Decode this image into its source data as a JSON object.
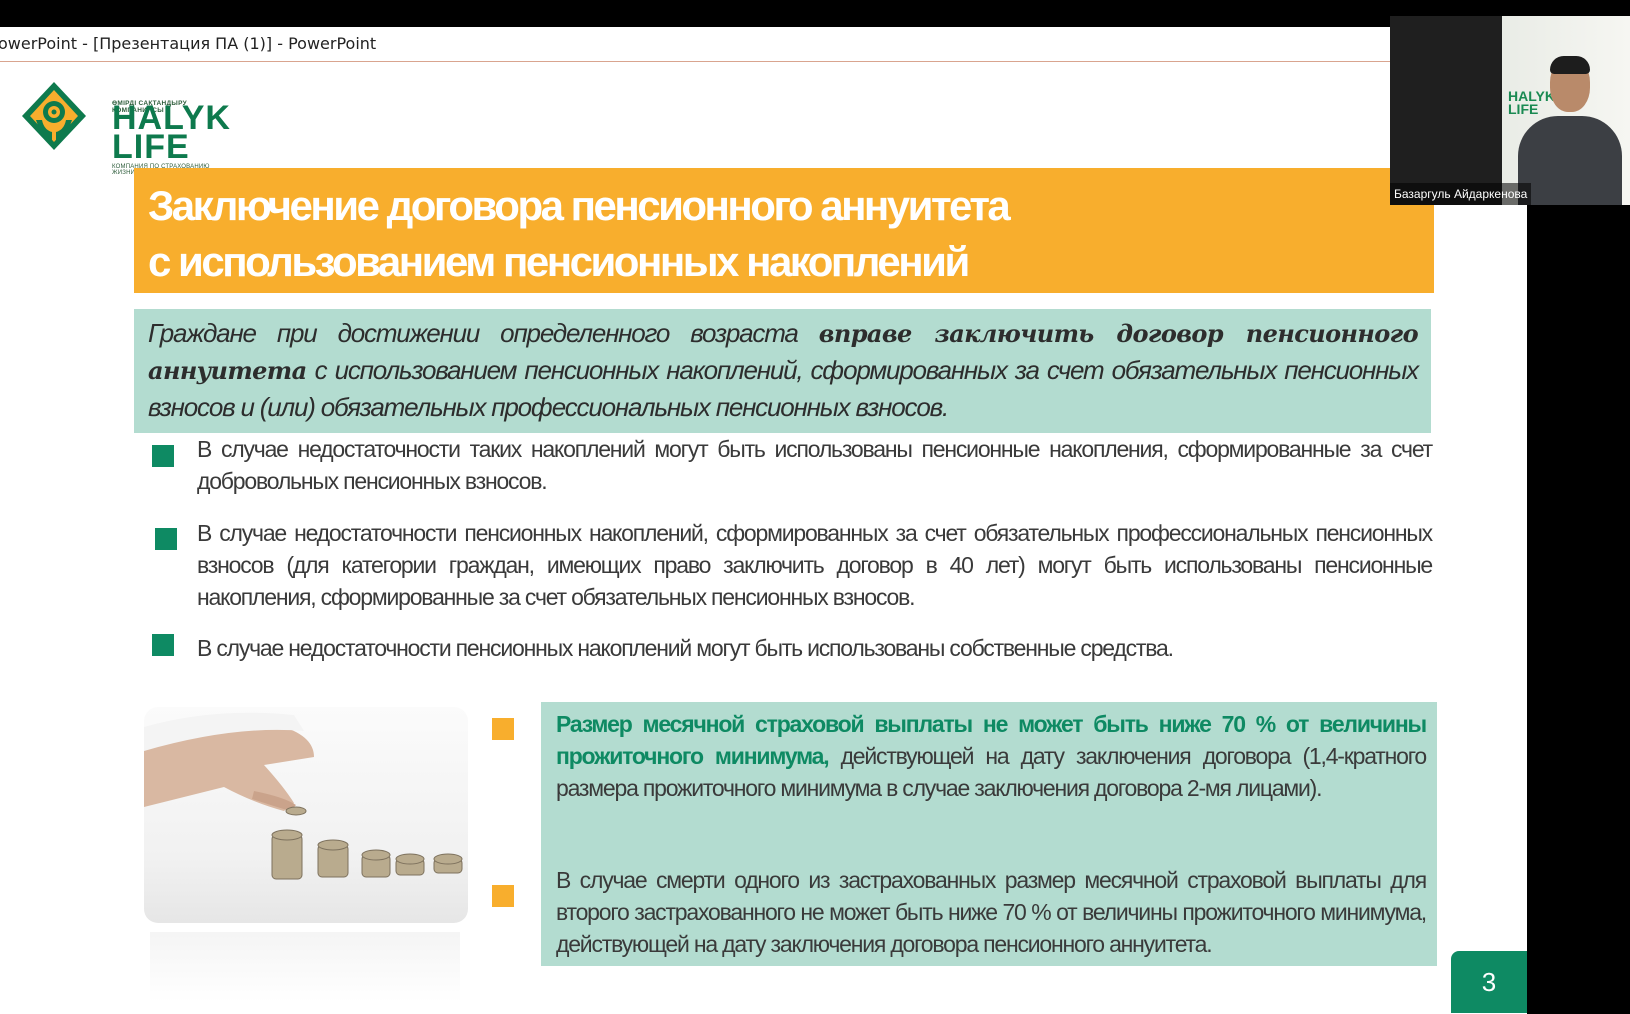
{
  "window": {
    "title": "owerPoint - [Презентация ПА (1)] - PowerPoint"
  },
  "logo": {
    "tagline": "ӨМІРДІ САҚТАНДЫРУ КОМПАНИЯСЫ",
    "word1": "HALYK",
    "word2": "LIFE",
    "subtitle": "КОМПАНИЯ ПО СТРАХОВАНИЮ ЖИЗНИ"
  },
  "slide": {
    "title_line1": "Заключение договора пенсионного аннуитета",
    "title_line2": "с использованием пенсионных накоплений",
    "intro_part1": "Граждане при достижении определенного возраста ",
    "intro_bold": "вправе заключить договор пенсионного аннуитета",
    "intro_part2": " с использованием пенсионных накоплений, сформированных за счет обязательных пенсионных взносов и (или) обязательных профессиональных пенсионных взносов.",
    "bullets": [
      "В случае недостаточности таких накоплений могут быть использованы пенсионные накопления, сформированные за счет добровольных пенсионных взносов.",
      "В случае недостаточности пенсионных накоплений, сформированных за счет обязательных профессиональных пенсионных взносов (для категории граждан, имеющих право заключить договор в 40 лет) могут быть использованы пенсионные накопления, сформированные за счет обязательных пенсионных взносов.",
      "В случае недостаточности пенсионных накоплений могут быть использованы собственные средства."
    ],
    "info_highlight": "Размер месячной страховой выплаты не может быть ниже 70 % от величины прожиточного минимума,",
    "info_rest": " действующей на дату заключения договора  (1,4-кратного размера прожиточного минимума в случае заключения договора 2-мя лицами).",
    "info_second": "В случае смерти одного из застрахованных размер месячной страховой выплаты для второго застрахованного не может быть ниже 70 % от величины прожиточного минимума, действующей на дату заключения договора пенсионного аннуитета.",
    "page_number": "3"
  },
  "camera": {
    "participant_name": "Базаргуль Айдаркенова",
    "logo_text1": "HALYK",
    "logo_text2": "LIFE"
  },
  "colors": {
    "orange": "#f8ae2d",
    "green": "#0e8a63",
    "mint": "#b3dcd0"
  }
}
